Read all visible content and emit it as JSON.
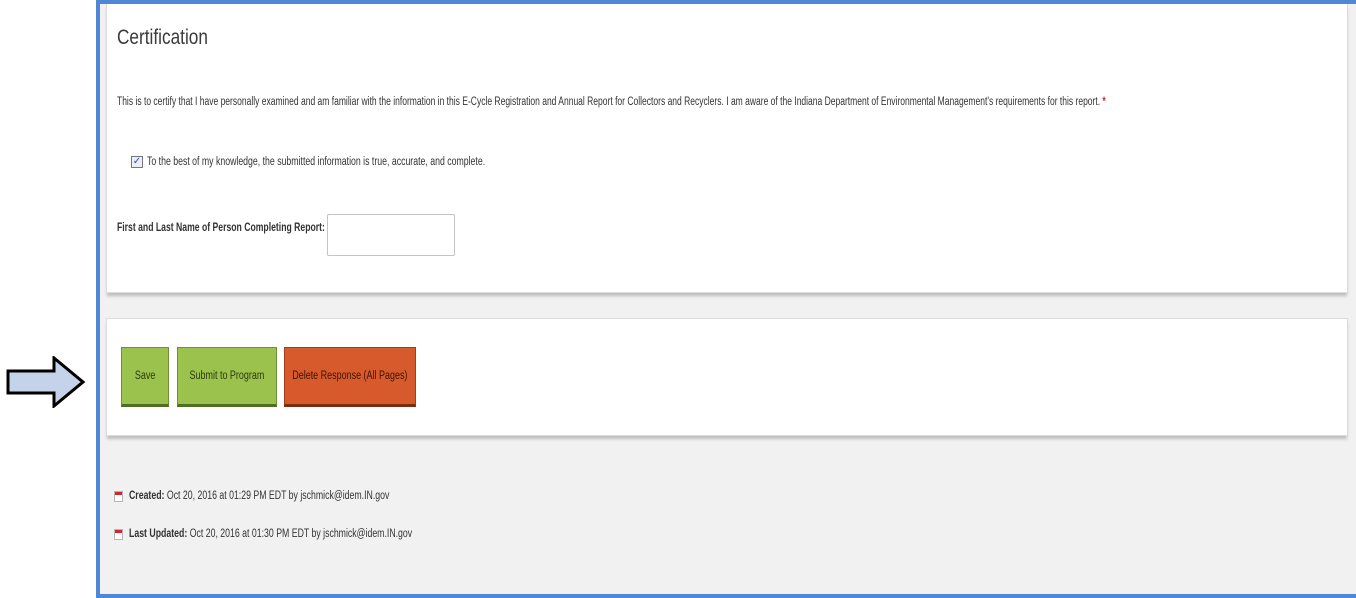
{
  "certification": {
    "title": "Certification",
    "statement": "This is to certify that I have personally examined and am familiar with the information in this E-Cycle Registration and Annual Report for Collectors and Recyclers. I am aware of the Indiana Department of Environmental Management's requirements for this report.",
    "required_marker": "*",
    "checkbox_checked": true,
    "checkbox_mark": "✓",
    "checkbox_label": "To the best of my knowledge, the submitted information is true, accurate, and complete.",
    "name_label": "First and Last Name of Person Completing Report:",
    "name_value": ""
  },
  "actions": {
    "save_label": "Save",
    "submit_label": "Submit to Program",
    "delete_label": "Delete Response (All Pages)"
  },
  "meta": {
    "created_label": "Created:",
    "created_value": "Oct 20, 2016 at 01:29 PM EDT by jschmick@idem.IN.gov",
    "updated_label": "Last Updated:",
    "updated_value": "Oct 20, 2016 at 01:30 PM EDT by jschmick@idem.IN.gov"
  },
  "colors": {
    "frame_border": "#4f86d6",
    "button_green": "#9ac24d",
    "button_red": "#d75a2c",
    "required": "#d9232e",
    "arrow_fill": "#c5d3ea"
  },
  "icons": {
    "annotation_arrow": "right-arrow-icon",
    "meta_icon": "calendar-icon"
  }
}
